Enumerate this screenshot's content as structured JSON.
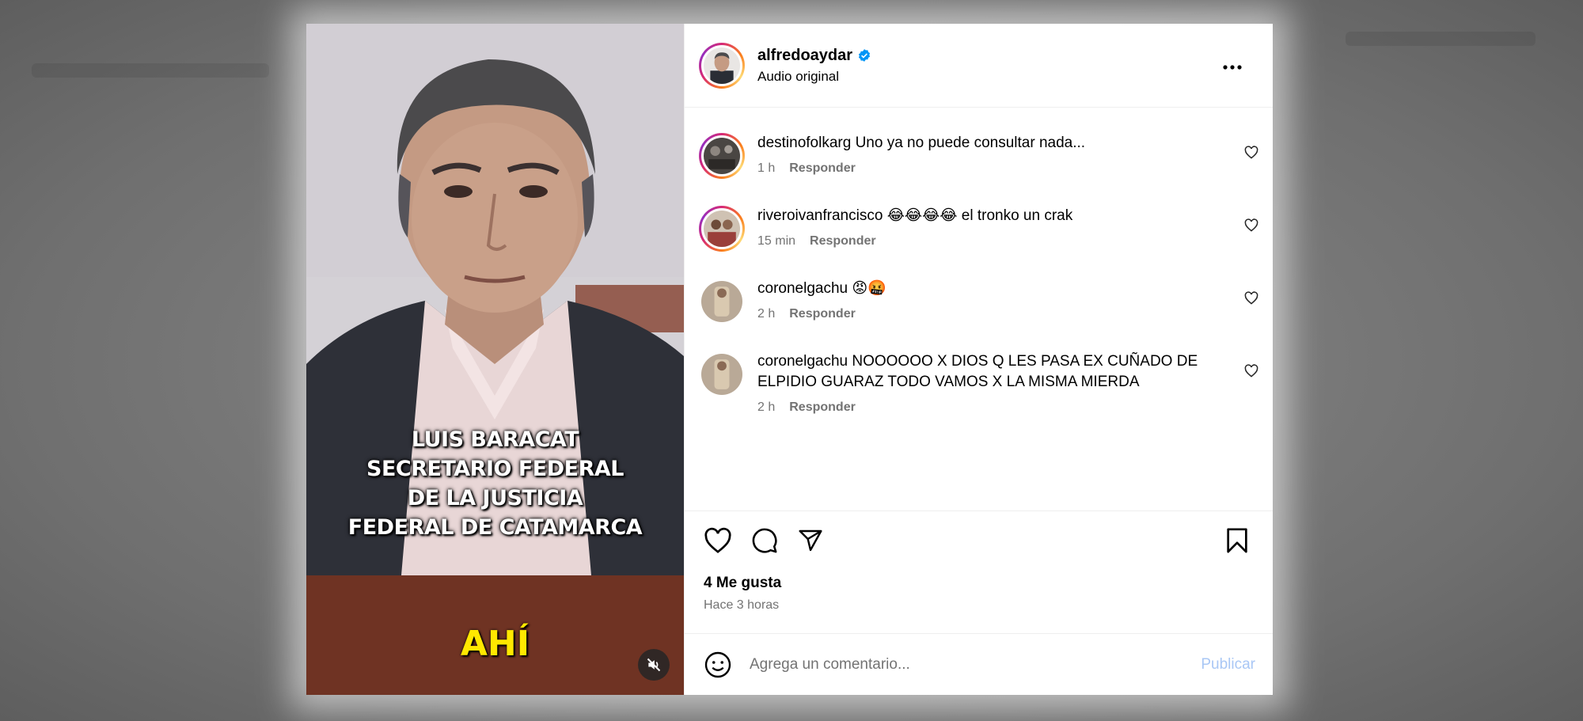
{
  "post": {
    "author": "alfredoaydar",
    "verified": true,
    "audio": "Audio original",
    "media": {
      "caption_lines": [
        "LUIS BARACAT",
        "SECRETARIO FEDERAL",
        "DE LA JUSTICIA",
        "FEDERAL DE CATAMARCA"
      ],
      "subtitle_word": "AHÍ",
      "muted": true
    },
    "likes": "4 Me gusta",
    "time_ago": "Hace 3 horas"
  },
  "comments": [
    {
      "user": "destinofolkarg",
      "text": "Uno ya no puede consultar nada...",
      "time": "1 h",
      "reply": "Responder",
      "story_ring": true
    },
    {
      "user": "riveroivanfrancisco",
      "text": "😂😂😂😂 el tronko un crak",
      "time": "15 min",
      "reply": "Responder",
      "story_ring": true
    },
    {
      "user": "coronelgachu",
      "text": "😡🤬",
      "time": "2 h",
      "reply": "Responder",
      "story_ring": false
    },
    {
      "user": "coronelgachu",
      "text": "NOOOOOO X DIOS Q LES PASA EX CUÑADO DE ELPIDIO GUARAZ TODO VAMOS X LA MISMA MIERDA",
      "time": "2 h",
      "reply": "Responder",
      "story_ring": false
    }
  ],
  "composer": {
    "placeholder": "Agrega un comentario...",
    "publish_label": "Publicar"
  },
  "icons": {
    "more": "more-horizontal-icon",
    "like": "heart-icon",
    "comment": "comment-bubble-icon",
    "share": "paper-plane-icon",
    "save": "bookmark-icon",
    "emoji": "emoji-smile-icon",
    "mute": "speaker-muted-icon",
    "verified": "verified-badge-icon"
  },
  "colors": {
    "verified": "#0095f6",
    "publish_disabled": "#a9c7f5",
    "meta_text": "#737373",
    "band": "#6f3323",
    "subtitle": "#ffe800"
  }
}
